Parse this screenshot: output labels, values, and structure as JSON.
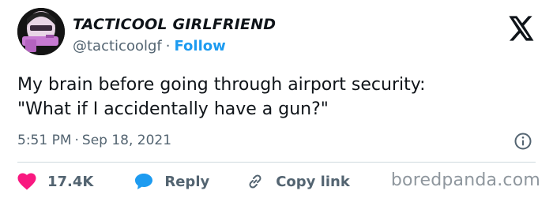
{
  "author": {
    "name": "TACTICOOL GIRLFRIEND",
    "handle": "@tacticoolgf",
    "separator": "·",
    "follow_label": "Follow"
  },
  "tweet": {
    "lines": [
      "My brain before going through airport security:",
      "\"What if I accidentally have a gun?\""
    ],
    "time": "5:51 PM",
    "separator": "·",
    "date": "Sep 18, 2021"
  },
  "actions": {
    "like_count": "17.4K",
    "reply_label": "Reply",
    "copy_link_label": "Copy link"
  },
  "watermark": "boredpanda.com",
  "icons": {
    "logo": "x-logo-icon",
    "info": "info-icon",
    "like": "heart-icon",
    "reply": "reply-bubble-icon",
    "copy": "link-icon"
  },
  "colors": {
    "text": "#0f1419",
    "muted": "#536471",
    "accent": "#1d9bf0",
    "like": "#f91880",
    "divider": "#cfd9de",
    "watermark": "#8f979e"
  }
}
